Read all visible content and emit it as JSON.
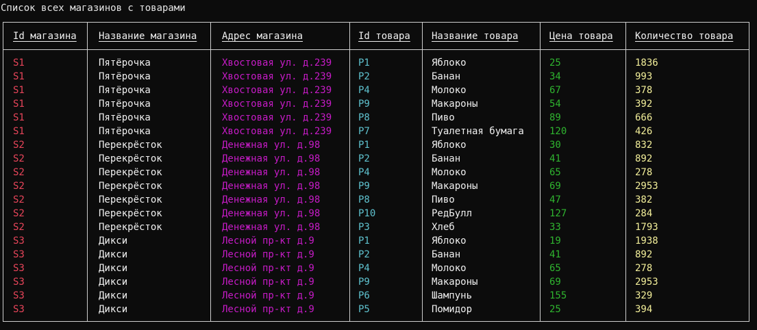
{
  "window": {
    "heading": "Список всех магазинов с товарами"
  },
  "table": {
    "headers": [
      "Id магазина",
      "Название магазина",
      "Адрес магазина",
      "Id товара",
      "Название товара",
      "Цена товара",
      "Количество товара"
    ],
    "rows": [
      [
        "S1",
        "Пятёрочка",
        "Хвостовая ул. д.239",
        "P1",
        "Яблоко",
        "25",
        "1836"
      ],
      [
        "S1",
        "Пятёрочка",
        "Хвостовая ул. д.239",
        "P2",
        "Банан",
        "34",
        "993"
      ],
      [
        "S1",
        "Пятёрочка",
        "Хвостовая ул. д.239",
        "P4",
        "Молоко",
        "67",
        "378"
      ],
      [
        "S1",
        "Пятёрочка",
        "Хвостовая ул. д.239",
        "P9",
        "Макароны",
        "54",
        "392"
      ],
      [
        "S1",
        "Пятёрочка",
        "Хвостовая ул. д.239",
        "P8",
        "Пиво",
        "89",
        "666"
      ],
      [
        "S1",
        "Пятёрочка",
        "Хвостовая ул. д.239",
        "P7",
        "Туалетная бумага",
        "120",
        "426"
      ],
      [
        "S2",
        "Перекрёсток",
        "Денежная ул. д.98",
        "P1",
        "Яблоко",
        "30",
        "832"
      ],
      [
        "S2",
        "Перекрёсток",
        "Денежная ул. д.98",
        "P2",
        "Банан",
        "41",
        "892"
      ],
      [
        "S2",
        "Перекрёсток",
        "Денежная ул. д.98",
        "P4",
        "Молоко",
        "65",
        "278"
      ],
      [
        "S2",
        "Перекрёсток",
        "Денежная ул. д.98",
        "P9",
        "Макароны",
        "69",
        "2953"
      ],
      [
        "S2",
        "Перекрёсток",
        "Денежная ул. д.98",
        "P8",
        "Пиво",
        "47",
        "382"
      ],
      [
        "S2",
        "Перекрёсток",
        "Денежная ул. д.98",
        "P10",
        "РедБулл",
        "127",
        "284"
      ],
      [
        "S2",
        "Перекрёсток",
        "Денежная ул. д.98",
        "P3",
        "Хлеб",
        "33",
        "1793"
      ],
      [
        "S3",
        "Дикси",
        "Лесной пр-кт д.9",
        "P1",
        "Яблоко",
        "19",
        "1938"
      ],
      [
        "S3",
        "Дикси",
        "Лесной пр-кт д.9",
        "P2",
        "Банан",
        "41",
        "892"
      ],
      [
        "S3",
        "Дикси",
        "Лесной пр-кт д.9",
        "P4",
        "Молоко",
        "65",
        "278"
      ],
      [
        "S3",
        "Дикси",
        "Лесной пр-кт д.9",
        "P9",
        "Макароны",
        "69",
        "2953"
      ],
      [
        "S3",
        "Дикси",
        "Лесной пр-кт д.9",
        "P6",
        "Шампунь",
        "155",
        "329"
      ],
      [
        "S3",
        "Дикси",
        "Лесной пр-кт д.9",
        "P5",
        "Помидор",
        "25",
        "394"
      ]
    ]
  },
  "colors": {
    "background": "#0c0c0c",
    "border": "#cfcfcf",
    "store_id": "#e8455a",
    "store_name": "#f0f0f0",
    "address": "#c71bc7",
    "product_id": "#5fc2cf",
    "product_name": "#f0f0f0",
    "price": "#2fb52f",
    "quantity": "#f3ef9a"
  }
}
